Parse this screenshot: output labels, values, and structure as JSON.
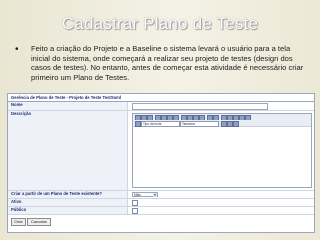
{
  "slide": {
    "title": "Cadastrar Plano de Teste",
    "bullet_symbol": "•",
    "bullet_text": "Feito a criação do Projeto e a Baseline o sistema levará o usuário para a tela inicial do sistema, onde começará a realizar seu projeto de testes (design dos casos de testes). No entanto, antes de começar esta atividade é necessário criar primeiro um Plano de Testes."
  },
  "app": {
    "header": "Gerência de Plano de Teste - Projeto de Teste TestSoml",
    "labels": {
      "nome": "Nome",
      "descricao": "Descrição",
      "criar_a_partir": "Criar a partir de um Plano de Teste existente?",
      "ativo": "Ativo",
      "publico": "Público"
    },
    "editor": {
      "font_type": "Tipo da fonte",
      "font_size": "Tamanho"
    },
    "select_value": "Não",
    "buttons": {
      "create": "Criar",
      "cancel": "Cancelar"
    }
  }
}
